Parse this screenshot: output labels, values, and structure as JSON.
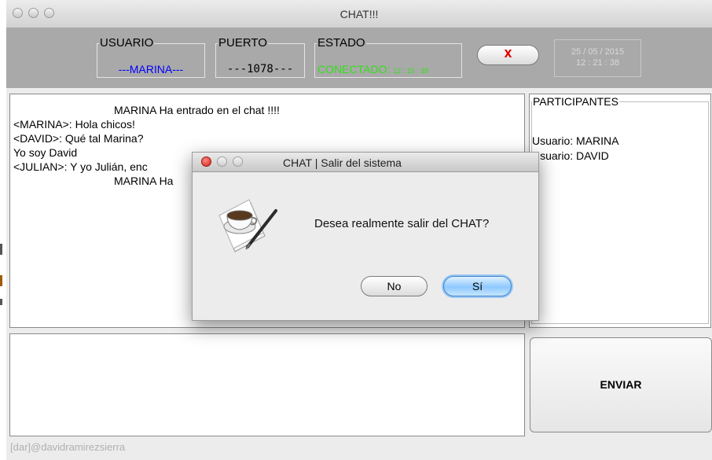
{
  "window": {
    "title": "CHAT!!!"
  },
  "header": {
    "usuario": {
      "label": "USUARIO",
      "value": "---MARINA---",
      "color": "#0000ff"
    },
    "puerto": {
      "label": "PUERTO",
      "value": "---1078---",
      "color": "#000000"
    },
    "estado": {
      "label": "ESTADO",
      "value": "CONECTADO:",
      "time": "12 : 15 : 39",
      "color": "#33e01a"
    },
    "close_label": "X",
    "date": "25 / 05 / 2015",
    "time": "12 : 21 : 38"
  },
  "chat": {
    "lines": [
      "MARINA Ha entrado en el chat !!!!",
      "<MARINA>:  Hola chicos!",
      "<DAVID>:  Qué tal Marina?",
      "Yo soy David",
      "<JULIAN>:  Y yo Julián, enc",
      "MARINA Ha"
    ]
  },
  "participants": {
    "title": "PARTICIPANTES",
    "items": [
      "Usuario: MARINA",
      "Usuario: DAVID"
    ]
  },
  "message": {
    "value": ""
  },
  "send_label": "ENVIAR",
  "footer": "[dar]@davidramirezsierra",
  "dialog": {
    "title": "CHAT | Salir del sistema",
    "message": "Desea realmente salir del CHAT?",
    "no_label": "No",
    "yes_label": "Sí",
    "icon": "coffee-pen-app-icon"
  }
}
